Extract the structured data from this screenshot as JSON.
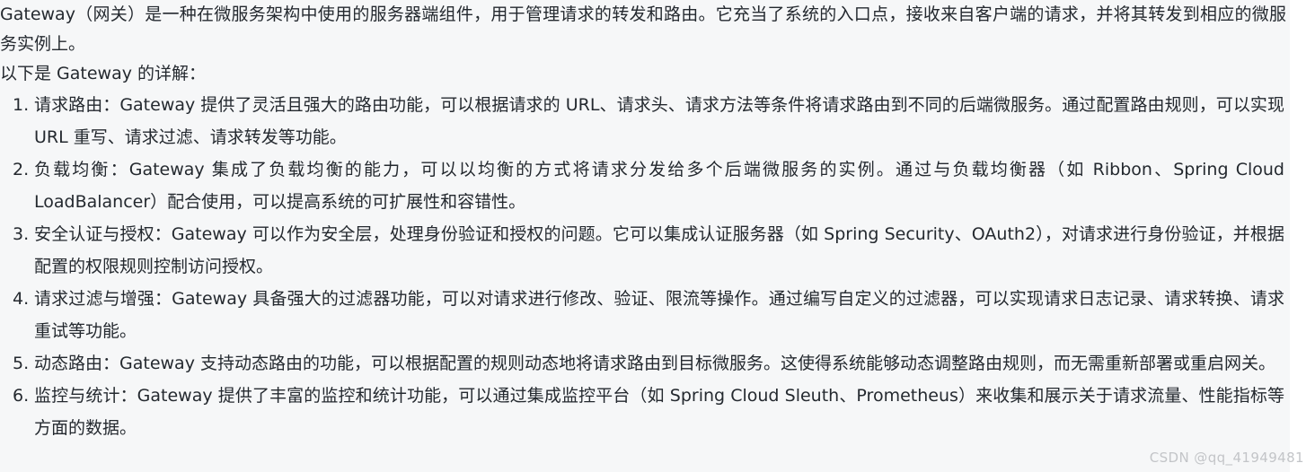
{
  "theme": {
    "page_background": "#ffffff",
    "content_background": "#f6f7f8",
    "text_color": "#24292f",
    "watermark_color": "#c3c5c8"
  },
  "article": {
    "intro_paragraph": "Gateway（网关）是一种在微服务架构中使用的服务器端组件，用于管理请求的转发和路由。它充当了系统的入口点，接收来自客户端的请求，并将其转发到相应的微服务实例上。",
    "lead_line": "以下是 Gateway 的详解：",
    "list_items": [
      {
        "index": "1",
        "text": "请求路由：Gateway 提供了灵活且强大的路由功能，可以根据请求的 URL、请求头、请求方法等条件将请求路由到不同的后端微服务。通过配置路由规则，可以实现 URL 重写、请求过滤、请求转发等功能。"
      },
      {
        "index": "2",
        "text": "负载均衡：Gateway 集成了负载均衡的能力，可以以均衡的方式将请求分发给多个后端微服务的实例。通过与负载均衡器（如 Ribbon、Spring Cloud LoadBalancer）配合使用，可以提高系统的可扩展性和容错性。"
      },
      {
        "index": "3",
        "text": "安全认证与授权：Gateway 可以作为安全层，处理身份验证和授权的问题。它可以集成认证服务器（如 Spring Security、OAuth2），对请求进行身份验证，并根据配置的权限规则控制访问授权。"
      },
      {
        "index": "4",
        "text": "请求过滤与增强：Gateway 具备强大的过滤器功能，可以对请求进行修改、验证、限流等操作。通过编写自定义的过滤器，可以实现请求日志记录、请求转换、请求重试等功能。"
      },
      {
        "index": "5",
        "text": "动态路由：Gateway 支持动态路由的功能，可以根据配置的规则动态地将请求路由到目标微服务。这使得系统能够动态调整路由规则，而无需重新部署或重启网关。"
      },
      {
        "index": "6",
        "text": "监控与统计：Gateway 提供了丰富的监控和统计功能，可以通过集成监控平台（如 Spring Cloud Sleuth、Prometheus）来收集和展示关于请求流量、性能指标等方面的数据。"
      }
    ]
  },
  "watermark": {
    "text": "CSDN @qq_41949481"
  }
}
